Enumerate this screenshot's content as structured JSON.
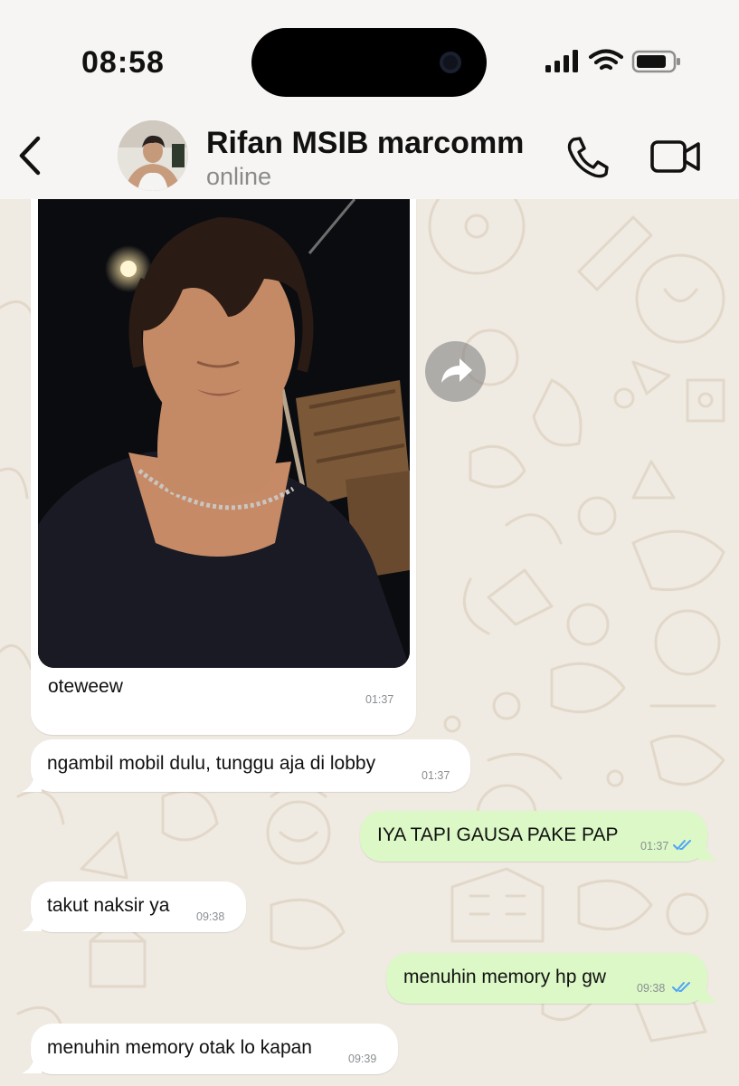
{
  "status_bar": {
    "time": "08:58"
  },
  "header": {
    "contact_name": "Rifan MSIB marcomm",
    "contact_status": "online"
  },
  "messages": [
    {
      "direction": "incoming",
      "type": "image",
      "caption": "oteweew",
      "time": "01:37"
    },
    {
      "direction": "incoming",
      "text": "ngambil mobil dulu, tunggu aja di lobby",
      "time": "01:37"
    },
    {
      "direction": "outgoing",
      "text": "IYA TAPI GAUSA PAKE PAP",
      "time": "01:37",
      "read": true
    },
    {
      "direction": "incoming",
      "text": "takut naksir ya",
      "time": "09:38"
    },
    {
      "direction": "outgoing",
      "text": "menuhin memory hp gw",
      "time": "09:38",
      "read": true
    },
    {
      "direction": "incoming",
      "text": "menuhin memory otak lo kapan",
      "time": "09:39"
    }
  ],
  "colors": {
    "wallpaper": "#efeae2",
    "incoming_bubble": "#ffffff",
    "outgoing_bubble": "#dcf8c6",
    "read_ticks": "#4fa4f5"
  }
}
